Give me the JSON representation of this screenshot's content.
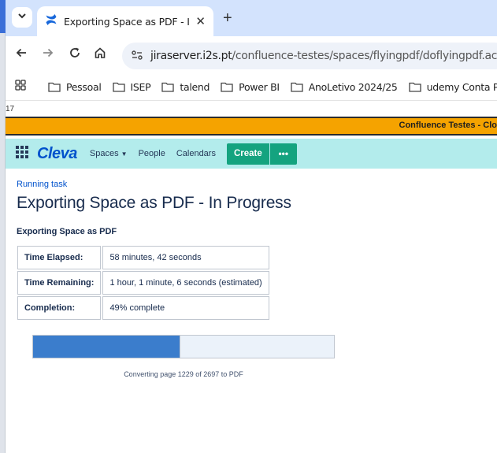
{
  "browser": {
    "tab": {
      "title": "Exporting Space as PDF - In Pro"
    },
    "address": {
      "host": "jiraserver.i2s.pt",
      "path": "/confluence-testes/spaces/flyingpdf/doflyingpdf.action?key"
    },
    "bookmarks": [
      "Pessoal",
      "ISEP",
      "talend",
      "Power BI",
      "AnoLetivo 2024/25",
      "udemy Conta Pess..."
    ]
  },
  "page_number": "17",
  "notice": {
    "text": "Confluence Testes - Clo"
  },
  "confluence": {
    "logo": "Cleva",
    "nav": {
      "spaces": "Spaces",
      "people": "People",
      "calendars": "Calendars"
    },
    "create_label": "Create",
    "more_label": "•••"
  },
  "task": {
    "breadcrumb": "Running task",
    "title": "Exporting Space as PDF - In Progress",
    "section_heading": "Exporting Space as PDF",
    "rows": [
      {
        "label": "Time Elapsed:",
        "value": "58 minutes, 42 seconds"
      },
      {
        "label": "Time Remaining:",
        "value": "1 hour, 1 minute, 6 seconds (estimated)"
      },
      {
        "label": "Completion:",
        "value": "49% complete"
      }
    ],
    "progress_percent": 49,
    "caption": "Converting page 1229 of 2697 to PDF"
  },
  "colors": {
    "tabbar": "#d3e3fd",
    "notice": "#f5a300",
    "confluence_header": "#b3ecec",
    "create_button": "#14a37f",
    "progress_fill": "#3b7dcc",
    "progress_track": "#ebf2fa",
    "link": "#0052cc"
  },
  "icons": [
    "tab-search-icon",
    "confluence-favicon",
    "close-icon",
    "new-tab-icon",
    "back-icon",
    "forward-icon",
    "reload-icon",
    "home-icon",
    "site-settings-icon",
    "apps-icon",
    "folder-icon",
    "app-switcher-icon",
    "chevron-down-icon"
  ]
}
